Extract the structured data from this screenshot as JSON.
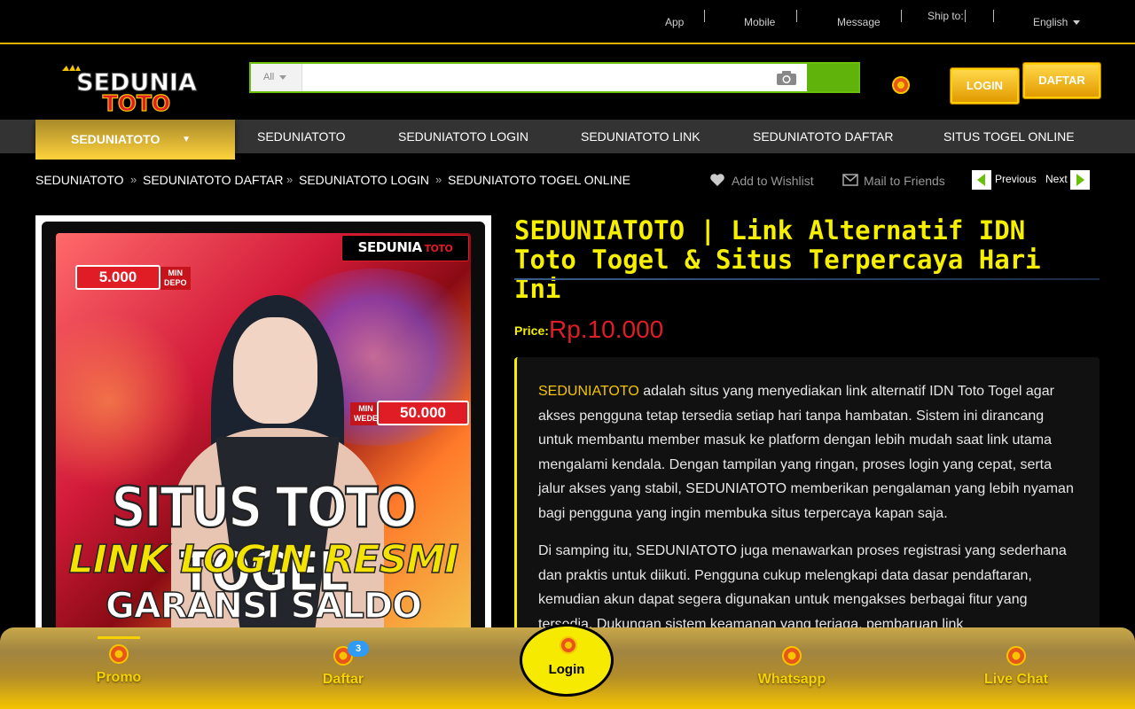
{
  "topbar": {
    "links": [
      "App",
      "Mobile",
      "Message",
      "Ship to:"
    ],
    "language": "English"
  },
  "logo": {
    "line1": "SEDUNIA",
    "line2": "TOTO"
  },
  "search": {
    "category": "All",
    "query": ""
  },
  "header": {
    "login_label": "LOGIN",
    "daftar_label": "DAFTAR"
  },
  "nav": {
    "category_label": "SEDUNIATOTO",
    "items": [
      "SEDUNIATOTO",
      "SEDUNIATOTO LOGIN",
      "SEDUNIATOTO LINK",
      "SEDUNIATOTO DAFTAR",
      "SITUS TOGEL ONLINE"
    ]
  },
  "breadcrumb": [
    "SEDUNIATOTO",
    "SEDUNIATOTO DAFTAR",
    "SEDUNIATOTO LOGIN",
    "SEDUNIATOTO TOGEL ONLINE"
  ],
  "actions": {
    "wishlist": "Add to Wishlist",
    "mail": "Mail to Friends",
    "previous": "Previous",
    "next": "Next"
  },
  "poster": {
    "logo_line1": "SEDUNIA",
    "logo_line2": "TOTO",
    "min_depo_value": "5.000",
    "min_depo_label_1": "MIN",
    "min_depo_label_2": "DEPO",
    "min_wede_value": "50.000",
    "min_wede_label_1": "MIN",
    "min_wede_label_2": "WEDE",
    "headline_1": "SITUS TOTO TOGEL",
    "headline_2": "LINK LOGIN RESMI",
    "headline_3": "GARANSI SALDO KEMBALI"
  },
  "product": {
    "title": "SEDUNIATOTO | Link Alternatif IDN Toto Togel & Situs Terpercaya Hari Ini",
    "price_label": "Price:",
    "price_value": "Rp.10.000",
    "desc_highlight": "SEDUNIATOTO",
    "desc_p1": " adalah situs yang menyediakan link alternatif IDN Toto Togel agar akses pengguna tetap tersedia setiap hari tanpa hambatan. Sistem ini dirancang untuk membantu member masuk ke platform dengan lebih mudah saat link utama mengalami kendala. Dengan tampilan yang ringan, proses login yang cepat, serta jalur akses yang stabil, SEDUNIATOTO memberikan pengalaman yang lebih nyaman bagi pengguna yang ingin membuka situs terpercaya kapan saja.",
    "desc_p2": "Di samping itu, SEDUNIATOTO juga menawarkan proses registrasi yang sederhana dan praktis untuk diikuti. Pengguna cukup melengkapi data dasar pendaftaran, kemudian akun dapat segera digunakan untuk mengakses berbagai fitur yang tersedia. Dukungan sistem keamanan yang terjaga, pembaruan link"
  },
  "bottom_nav": {
    "items": [
      "Promo",
      "Daftar",
      "Whatsapp",
      "Live Chat"
    ],
    "center": "Login",
    "daftar_badge": "3"
  },
  "colors": {
    "accent_gold": "#f6ef00",
    "price_red": "#e01d25",
    "search_green": "#5fb30a"
  }
}
